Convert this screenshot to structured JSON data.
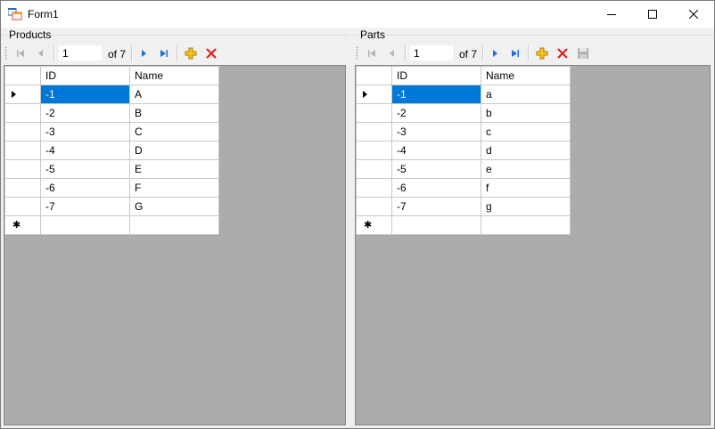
{
  "window": {
    "title": "Form1"
  },
  "panels": {
    "products": {
      "group_label": "Products",
      "navigator": {
        "position": "1",
        "count_label": "of 7"
      },
      "columns": [
        "ID",
        "Name"
      ],
      "rows": [
        {
          "id": "-1",
          "name": "A"
        },
        {
          "id": "-2",
          "name": "B"
        },
        {
          "id": "-3",
          "name": "C"
        },
        {
          "id": "-4",
          "name": "D"
        },
        {
          "id": "-5",
          "name": "E"
        },
        {
          "id": "-6",
          "name": "F"
        },
        {
          "id": "-7",
          "name": "G"
        }
      ]
    },
    "parts": {
      "group_label": "Parts",
      "navigator": {
        "position": "1",
        "count_label": "of 7"
      },
      "columns": [
        "ID",
        "Name"
      ],
      "rows": [
        {
          "id": "-1",
          "name": "a"
        },
        {
          "id": "-2",
          "name": "b"
        },
        {
          "id": "-3",
          "name": "c"
        },
        {
          "id": "-4",
          "name": "d"
        },
        {
          "id": "-5",
          "name": "e"
        },
        {
          "id": "-6",
          "name": "f"
        },
        {
          "id": "-7",
          "name": "g"
        }
      ]
    }
  },
  "colors": {
    "selection": "#0078d7",
    "grid_background": "#ababab",
    "nav_arrow": "#1e6fd9",
    "add_icon": "#e8a317",
    "delete_icon": "#e02020"
  },
  "icons": [
    "form-icon",
    "minimize-icon",
    "maximize-icon",
    "close-icon",
    "move-first-icon",
    "move-previous-icon",
    "move-next-icon",
    "move-last-icon",
    "add-new-icon",
    "delete-icon",
    "save-icon",
    "current-row-arrow-icon",
    "new-row-star-icon"
  ]
}
